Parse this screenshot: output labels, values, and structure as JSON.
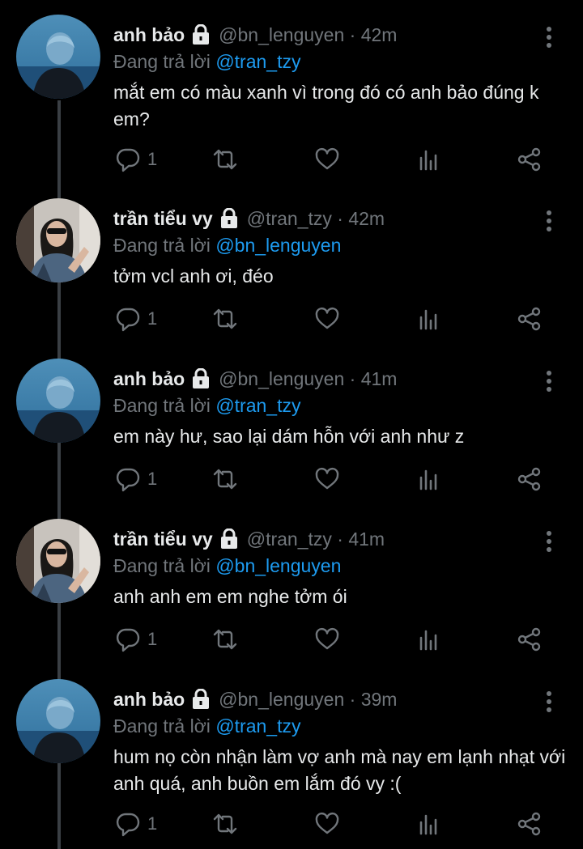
{
  "reply_prefix": "Đang trả lời",
  "colors": {
    "background": "#000000",
    "text": "#e7e9ea",
    "muted": "#71767b",
    "mention": "#1d9bf0",
    "thread_line": "#3a3f44"
  },
  "icons": [
    "lock-icon",
    "more-vertical-icon",
    "reply-icon",
    "retweet-icon",
    "like-icon",
    "analytics-icon",
    "share-icon"
  ],
  "tweets": [
    {
      "name": "anh bảo",
      "handle": "@bn_lenguyen · 42m",
      "reply_to": "@tran_tzy",
      "text": "mắt em có màu xanh vì trong đó có anh bảo đúng k em?",
      "reply_count": "1",
      "avatar": "blue-hair"
    },
    {
      "name": "trần tiểu vy",
      "handle": "@tran_tzy · 42m",
      "reply_to": "@bn_lenguyen",
      "text": "tởm vcl anh ơi, đéo",
      "reply_count": "1",
      "avatar": "sunglasses"
    },
    {
      "name": "anh bảo",
      "handle": "@bn_lenguyen · 41m",
      "reply_to": "@tran_tzy",
      "text": "em này hư, sao lại dám hỗn với anh như z",
      "reply_count": "1",
      "avatar": "blue-hair"
    },
    {
      "name": "trần tiểu vy",
      "handle": "@tran_tzy · 41m",
      "reply_to": "@bn_lenguyen",
      "text": "anh anh em em nghe tởm ói",
      "reply_count": "1",
      "avatar": "sunglasses"
    },
    {
      "name": "anh bảo",
      "handle": "@bn_lenguyen · 39m",
      "reply_to": "@tran_tzy",
      "text": "hum nọ còn nhận làm vợ anh mà nay em lạnh nhạt với anh quá, anh buồn em lắm đó vy :(",
      "reply_count": "1",
      "avatar": "blue-hair"
    }
  ]
}
